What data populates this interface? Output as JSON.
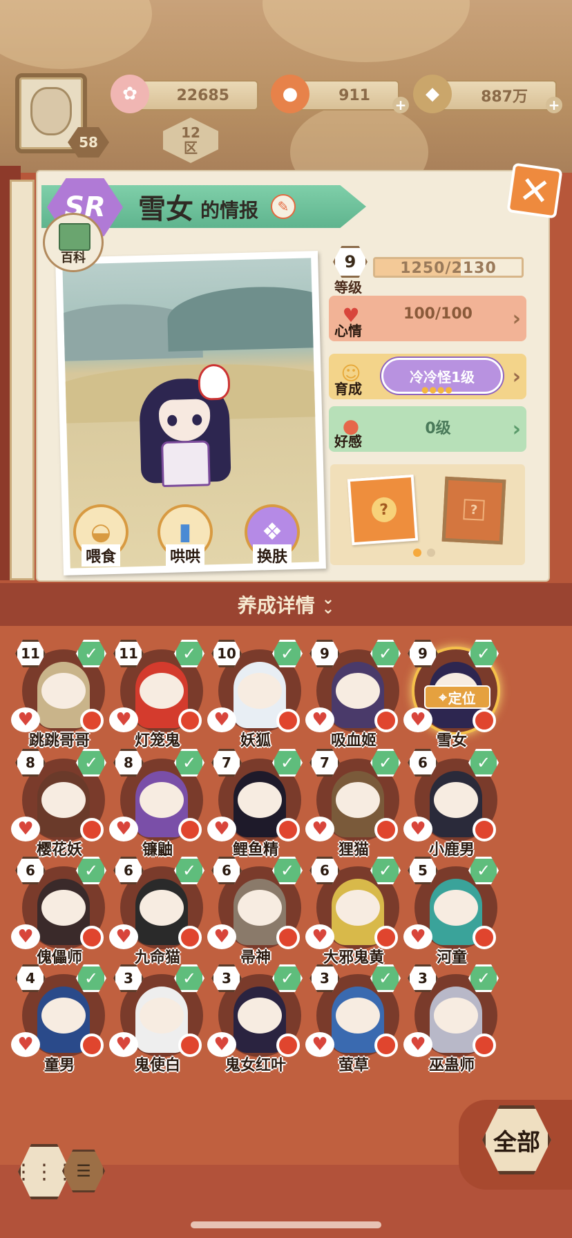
{
  "resources": {
    "player_level": "58",
    "flower": "22685",
    "coin": "911",
    "money": "887万",
    "zone_number": "12",
    "zone_label": "区"
  },
  "profile": {
    "rarity": "SR",
    "name": "雪女",
    "title_suffix": "的情报",
    "encyclopedia_label": "百科",
    "actions": [
      {
        "label": "喂食",
        "icon": "noodle-bowl-icon"
      },
      {
        "label": "哄哄",
        "icon": "milk-carton-icon"
      },
      {
        "label": "换肤",
        "icon": "kimono-icon"
      }
    ]
  },
  "stats": {
    "level": "9",
    "level_label": "等级",
    "exp_current": "1250",
    "exp_max": "2130",
    "exp_fraction": 0.587,
    "mood_label": "心情",
    "mood_value": "100/100",
    "cultivate_label": "育成",
    "cultivate_value": "冷冷怪1级",
    "cultivate_stars": "●●●●",
    "favor_label": "好感",
    "favor_value": "0级",
    "card_mystery": "?"
  },
  "section": {
    "title": "养成详情"
  },
  "locate_label": "定位",
  "pets": [
    {
      "name": "跳跳哥哥",
      "level": "11",
      "color": "#c9b48a"
    },
    {
      "name": "灯笼鬼",
      "level": "11",
      "color": "#d43b2d"
    },
    {
      "name": "妖狐",
      "level": "10",
      "color": "#e8eef4"
    },
    {
      "name": "吸血姬",
      "level": "9",
      "color": "#4a3a6a"
    },
    {
      "name": "雪女",
      "level": "9",
      "color": "#2d2650"
    },
    {
      "name": "樱花妖",
      "level": "8",
      "color": "#6a3a2a"
    },
    {
      "name": "镰鼬",
      "level": "8",
      "color": "#7a4fa8"
    },
    {
      "name": "鲤鱼精",
      "level": "7",
      "color": "#1e1a2a"
    },
    {
      "name": "狸猫",
      "level": "7",
      "color": "#7a5a3a"
    },
    {
      "name": "小鹿男",
      "level": "6",
      "color": "#2a2a3a"
    },
    {
      "name": "傀儡师",
      "level": "6",
      "color": "#3a2a2a"
    },
    {
      "name": "九命猫",
      "level": "6",
      "color": "#2a2a2a"
    },
    {
      "name": "帚神",
      "level": "6",
      "color": "#8a7a6a"
    },
    {
      "name": "大邪鬼黄",
      "level": "6",
      "color": "#d8b94a"
    },
    {
      "name": "河童",
      "level": "5",
      "color": "#3aa39a"
    },
    {
      "name": "童男",
      "level": "4",
      "color": "#2a4a8a"
    },
    {
      "name": "鬼使白",
      "level": "3",
      "color": "#eeeeee"
    },
    {
      "name": "鬼女红叶",
      "level": "3",
      "color": "#2a2340"
    },
    {
      "name": "萤草",
      "level": "3",
      "color": "#3a6ab0"
    },
    {
      "name": "巫蛊师",
      "level": "3",
      "color": "#b8b8c8"
    }
  ],
  "bottom": {
    "all_label": "全部"
  }
}
